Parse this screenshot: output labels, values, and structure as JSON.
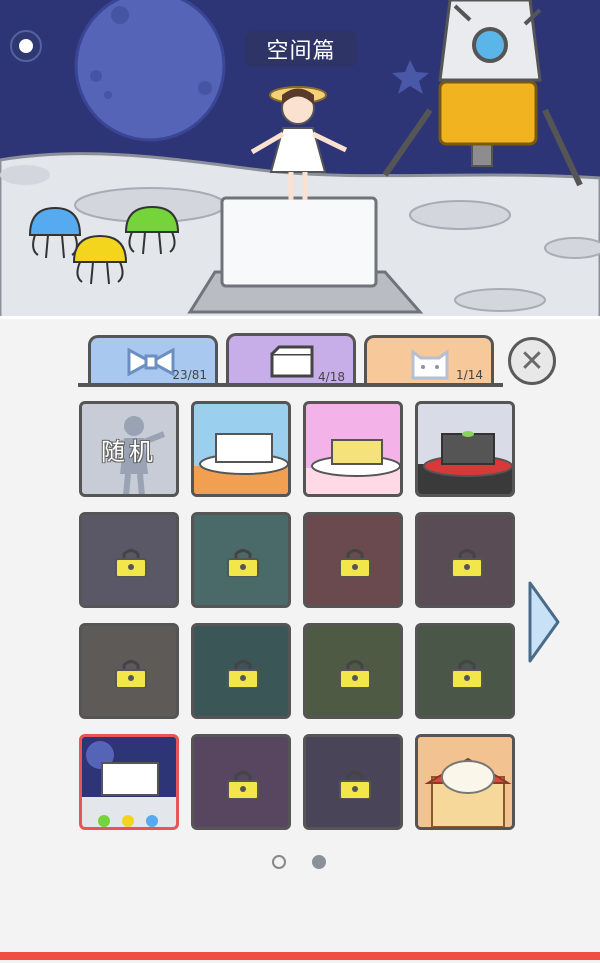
{
  "header": {
    "title": "空间篇"
  },
  "scene": {
    "sky_color": "#2d3576",
    "ground_color": "#e3e6ea"
  },
  "tabs": [
    {
      "name": "accessories",
      "count": "23/81",
      "color": "#a9c8f0",
      "icon": "bow-icon"
    },
    {
      "name": "pedestals",
      "count": "4/18",
      "color": "#c8aee8",
      "icon": "pedestal-icon",
      "active": true
    },
    {
      "name": "pets",
      "count": "1/14",
      "color": "#f6c89a",
      "icon": "cat-icon"
    }
  ],
  "grid": {
    "random_label": "随机",
    "items": [
      {
        "kind": "random"
      },
      {
        "kind": "tofu-orange-cloth",
        "locked": false
      },
      {
        "kind": "butter-pink",
        "locked": false
      },
      {
        "kind": "dark-tofu-red",
        "locked": false
      },
      {
        "kind": "cake-stand",
        "locked": true
      },
      {
        "kind": "fruit-cake",
        "locked": true
      },
      {
        "kind": "red-plate",
        "locked": true
      },
      {
        "kind": "basket",
        "locked": true
      },
      {
        "kind": "kitchen",
        "locked": true
      },
      {
        "kind": "teal-desk",
        "locked": true
      },
      {
        "kind": "garden-hook",
        "locked": true
      },
      {
        "kind": "dark-stone",
        "locked": true
      },
      {
        "kind": "moon-tofu",
        "locked": false,
        "selected": true
      },
      {
        "kind": "purple-table",
        "locked": true
      },
      {
        "kind": "machine",
        "locked": true
      },
      {
        "kind": "sushi-tray",
        "locked": false
      }
    ]
  },
  "pagination": {
    "current": 2,
    "total": 2
  }
}
